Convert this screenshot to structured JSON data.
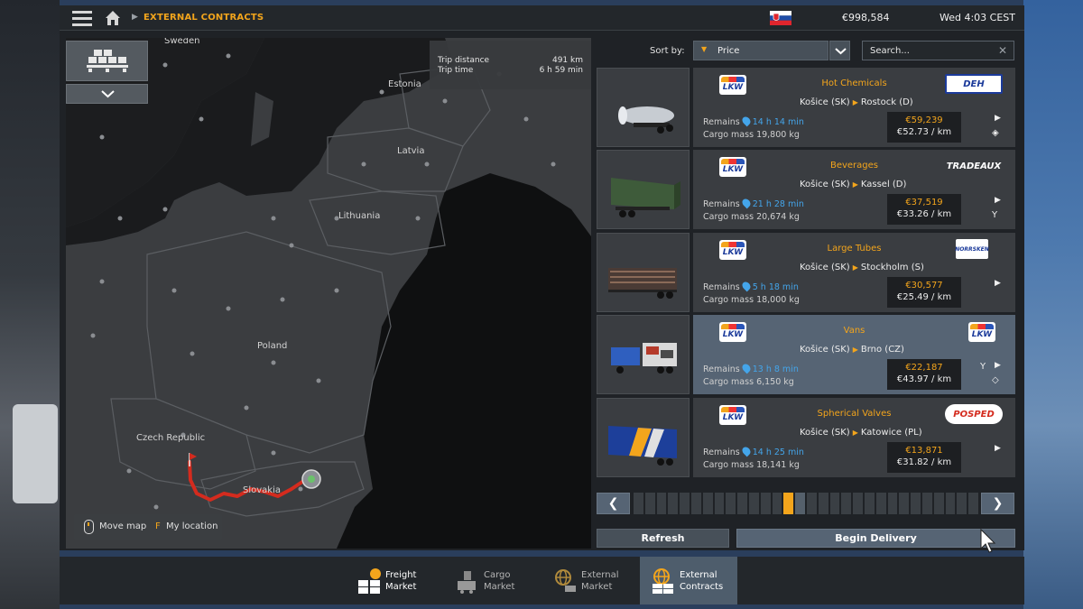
{
  "header": {
    "breadcrumb": "EXTERNAL CONTRACTS",
    "money": "€998,584",
    "clock": "Wed 4:03 CEST"
  },
  "map": {
    "labels": {
      "sweden": "Sweden",
      "estonia": "Estonia",
      "latvia": "Latvia",
      "lithuania": "Lithuania",
      "poland": "Poland",
      "czech": "Czech Republic",
      "slovakia": "Slovakia"
    },
    "trip": {
      "distance_label": "Trip distance",
      "distance_value": "491 km",
      "time_label": "Trip time",
      "time_value": "6 h 59 min"
    },
    "hints": {
      "move_map": "Move map",
      "key_f": "F",
      "my_location": "My location"
    }
  },
  "sort": {
    "label": "Sort by:",
    "value": "Price",
    "search_placeholder": "Search..."
  },
  "jobs": [
    {
      "cargo": "Hot Chemicals",
      "from": "Košice (SK)",
      "to": "Rostock (D)",
      "remains_label": "Remains",
      "remains": "14 h 14 min",
      "mass_label": "Cargo mass",
      "mass": "19,800 kg",
      "pay": "€59,239",
      "per_km": "€52.73 / km",
      "company": "DEH"
    },
    {
      "cargo": "Beverages",
      "from": "Košice (SK)",
      "to": "Kassel (D)",
      "remains_label": "Remains",
      "remains": "21 h 28 min",
      "mass_label": "Cargo mass",
      "mass": "20,674 kg",
      "pay": "€37,519",
      "per_km": "€33.26 / km",
      "company": "TRADEAUX"
    },
    {
      "cargo": "Large Tubes",
      "from": "Košice (SK)",
      "to": "Stockholm (S)",
      "remains_label": "Remains",
      "remains": "5 h 18 min",
      "mass_label": "Cargo mass",
      "mass": "18,000 kg",
      "pay": "€30,577",
      "per_km": "€25.49 / km",
      "company": "NORRSKEN"
    },
    {
      "cargo": "Vans",
      "from": "Košice (SK)",
      "to": "Brno (CZ)",
      "remains_label": "Remains",
      "remains": "13 h 8 min",
      "mass_label": "Cargo mass",
      "mass": "6,150 kg",
      "pay": "€22,187",
      "per_km": "€43.97 / km",
      "company": "LKW"
    },
    {
      "cargo": "Spherical Valves",
      "from": "Košice (SK)",
      "to": "Katowice (PL)",
      "remains_label": "Remains",
      "remains": "14 h 25 min",
      "mass_label": "Cargo mass",
      "mass": "18,141 kg",
      "pay": "€13,871",
      "per_km": "€31.82 / km",
      "company": "POSPED"
    }
  ],
  "lkw_logo": "LKW",
  "buttons": {
    "refresh": "Refresh",
    "begin": "Begin Delivery"
  },
  "tabs": [
    {
      "line1": "Freight",
      "line2": "Market"
    },
    {
      "line1": "Cargo",
      "line2": "Market"
    },
    {
      "line1": "External",
      "line2": "Market"
    },
    {
      "line1": "External",
      "line2": "Contracts"
    }
  ],
  "colors": {
    "accent": "#f3a51c",
    "time_blue": "#44a5ea",
    "selected": "#566474",
    "route_red": "#d42b1e"
  }
}
